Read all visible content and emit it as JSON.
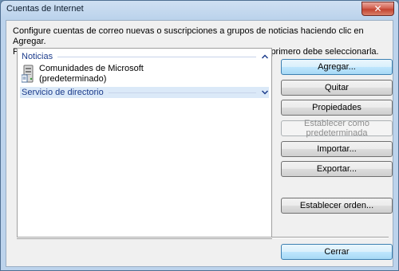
{
  "window": {
    "title": "Cuentas de Internet",
    "close_icon": "close-icon"
  },
  "description": {
    "line1": "Configure cuentas de correo nuevas o suscripciones a grupos de noticias haciendo clic en Agregar.",
    "line2": "Para realizar cambios, exportar o quitar una cuenta o suscripción, primero debe seleccionarla."
  },
  "accounts_list": {
    "groups": [
      {
        "label": "Noticias",
        "expanded": true,
        "items": [
          {
            "name": "Comunidades de Microsoft",
            "detail": "(predeterminado)",
            "icon": "news-server-icon"
          }
        ]
      },
      {
        "label": "Servicio de directorio",
        "expanded": false,
        "items": []
      }
    ]
  },
  "buttons": {
    "add": "Agregar...",
    "remove": "Quitar",
    "properties": "Propiedades",
    "set_default": "Establecer como predeterminada",
    "import": "Importar...",
    "export": "Exportar...",
    "set_order": "Establecer orden...",
    "close": "Cerrar"
  },
  "colors": {
    "accent": "#3c7fb1",
    "group_header_text": "#1c3c8c",
    "disabled_text": "#8d8d8d"
  }
}
